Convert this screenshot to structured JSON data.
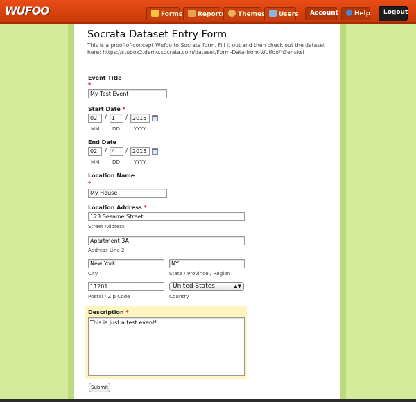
{
  "brand": {
    "logo": "WUFOO"
  },
  "nav": {
    "forms": "Forms",
    "reports": "Reports",
    "themes": "Themes",
    "users": "Users",
    "account": "Account",
    "help": "Help",
    "logout": "Logout"
  },
  "form": {
    "title": "Socrata Dataset Entry Form",
    "description": "This is a proof-of-concept Wufoo to Socrata form. Fill it out and then check out the dataset here: https://stubox2.demo.socrata.com/dataset/Form-Data-from-Wuffoo/h3er-sksi",
    "required_mark": "*",
    "event_title": {
      "label": "Event Title",
      "value": "My Test Event"
    },
    "start_date": {
      "label": "Start Date",
      "mm": "02",
      "dd": "1",
      "yyyy": "2015",
      "mm_label": "MM",
      "dd_label": "DD",
      "yyyy_label": "YYYY",
      "sep": "/"
    },
    "end_date": {
      "label": "End Date",
      "mm": "02",
      "dd": "4",
      "yyyy": "2015",
      "mm_label": "MM",
      "dd_label": "DD",
      "yyyy_label": "YYYY",
      "sep": "/"
    },
    "location_name": {
      "label": "Location Name",
      "value": "My House"
    },
    "location_address": {
      "label": "Location Address",
      "street": "123 Sesame Street",
      "street_label": "Street Address",
      "line2": "Apartment 3A",
      "line2_label": "Address Line 2",
      "city": "New York",
      "city_label": "City",
      "state": "NY",
      "state_label": "State / Province / Region",
      "zip": "11201",
      "zip_label": "Postal / Zip Code",
      "country": "United States",
      "country_label": "Country"
    },
    "description_field": {
      "label": "Description",
      "value": "This is just a test event!"
    },
    "submit": "Submit"
  }
}
